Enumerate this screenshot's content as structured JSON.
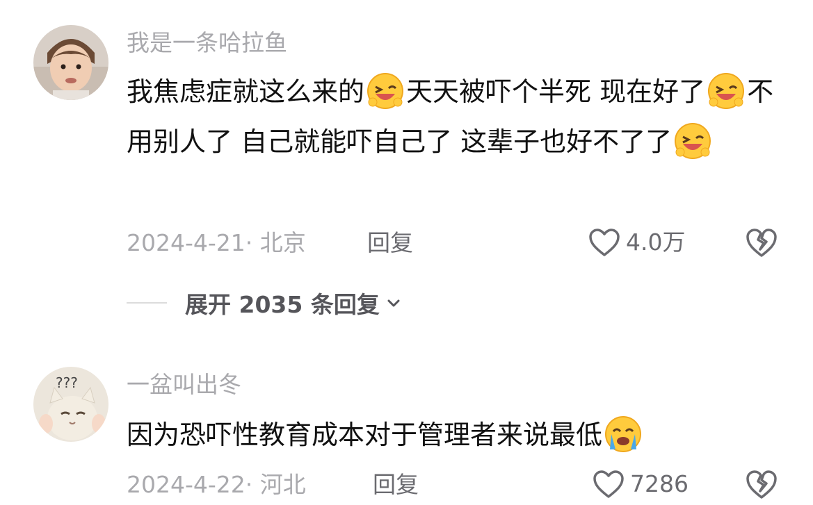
{
  "comments": [
    {
      "username": "我是一条哈拉鱼",
      "text_parts": [
        "我焦虑症就这么来的",
        "天天被吓个半死 现在好了",
        "不用别人了 自己就能吓自己了 这辈子也好不了了"
      ],
      "date": "2024-4-21",
      "location": "北京",
      "reply_label": "回复",
      "likes": "4.0万",
      "expand_label": "展开 2035 条回复",
      "emoji": "laughing-wink-emoji"
    },
    {
      "username": "一盆叫出冬",
      "text": "因为恐吓性教育成本对于管理者来说最低",
      "date": "2024-4-22",
      "location": "河北",
      "reply_label": "回复",
      "likes": "7286",
      "emoji": "crying-emoji"
    }
  ],
  "colors": {
    "secondary_text": "#a9a9ad",
    "primary_text": "#111111",
    "emoji_yellow": "#ffcb3d"
  }
}
